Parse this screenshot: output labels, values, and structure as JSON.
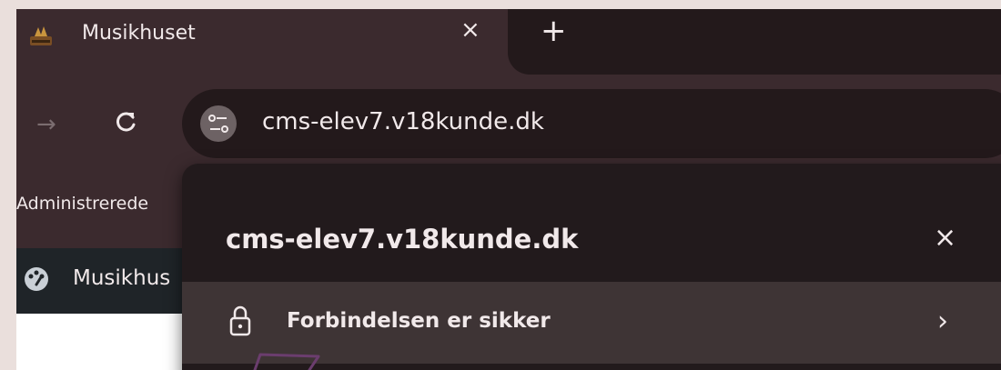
{
  "tab": {
    "title": "Musikhuset",
    "close_icon": "×",
    "new_tab_icon": "+"
  },
  "toolbar": {
    "forward_icon": "→",
    "url": "cms-elev7.v18kunde.dk"
  },
  "bookmarks": {
    "item_label": "Administrerede"
  },
  "page": {
    "header_title": "Musikhus"
  },
  "popup": {
    "site": "cms-elev7.v18kunde.dk",
    "close_icon": "×",
    "connection_label": "Forbindelsen er sikker",
    "chevron_icon": "›"
  },
  "colors": {
    "tab_bg": "#3b2a2e",
    "strip_bg": "#23191b",
    "popup_bg": "#221a1c",
    "row_bg": "#3e3435",
    "annotation": "#6b3d6e"
  }
}
